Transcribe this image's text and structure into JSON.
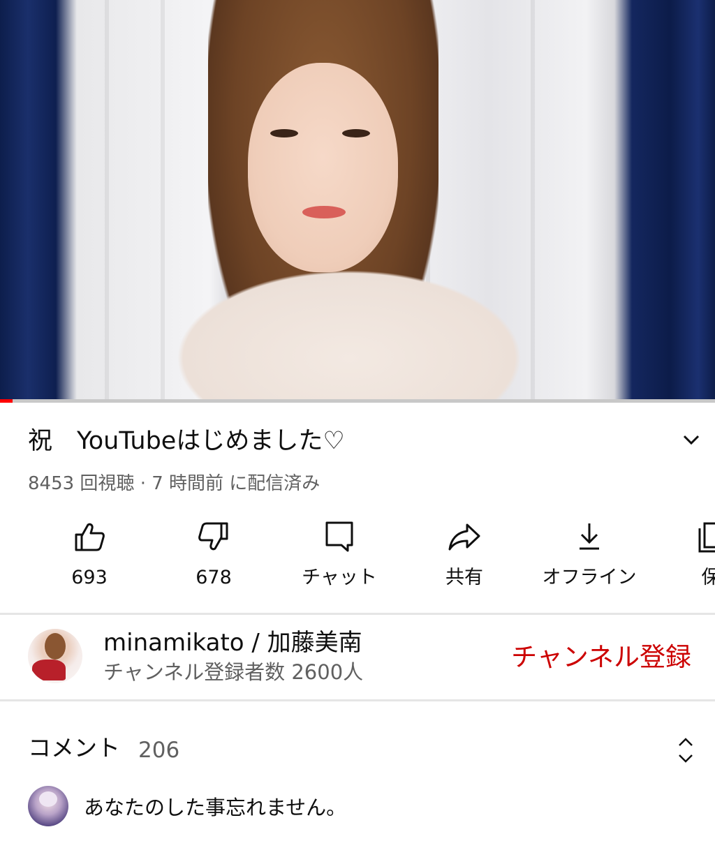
{
  "video": {
    "progress_fraction": 0.018,
    "progress_color": "#ff0000"
  },
  "title": "祝　YouTubeはじめました♡",
  "meta": "8453 回視聴 · 7 時間前 に配信済み",
  "actions": [
    {
      "icon": "thumbs-up-icon",
      "label": "693"
    },
    {
      "icon": "thumbs-down-icon",
      "label": "678"
    },
    {
      "icon": "chat-icon",
      "label": "チャット"
    },
    {
      "icon": "share-icon",
      "label": "共有"
    },
    {
      "icon": "download-icon",
      "label": "オフライン"
    },
    {
      "icon": "save-icon",
      "label": "保"
    }
  ],
  "channel": {
    "name": "minamikato / 加藤美南",
    "subscribers": "チャンネル登録者数 2600人",
    "subscribe_label": "チャンネル登録",
    "subscribe_color": "#cc0000"
  },
  "comments": {
    "label": "コメント",
    "count": "206",
    "first_comment": "あなたのした事忘れません。"
  }
}
